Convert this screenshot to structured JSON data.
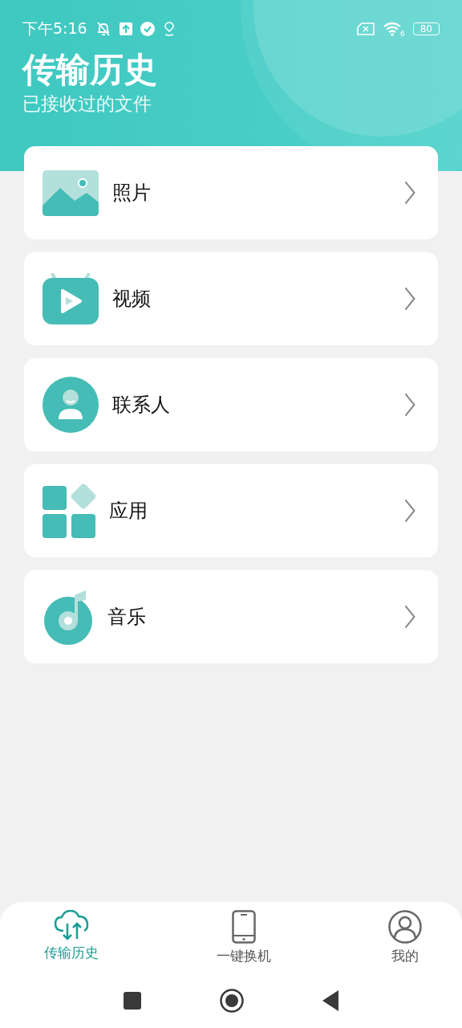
{
  "status_bar": {
    "time": "下午5:16",
    "wifi_label": "6",
    "battery": "80"
  },
  "header": {
    "title": "传输历史",
    "subtitle": "已接收过的文件"
  },
  "items": [
    {
      "kind": "photo",
      "label": "照片"
    },
    {
      "kind": "video",
      "label": "视频"
    },
    {
      "kind": "contact",
      "label": "联系人"
    },
    {
      "kind": "app",
      "label": "应用"
    },
    {
      "kind": "music",
      "label": "音乐"
    }
  ],
  "tabs": [
    {
      "kind": "cloud",
      "label": "传输历史",
      "selected": true
    },
    {
      "kind": "phone",
      "label": "一键换机",
      "selected": false
    },
    {
      "kind": "user",
      "label": "我的",
      "selected": false
    }
  ]
}
